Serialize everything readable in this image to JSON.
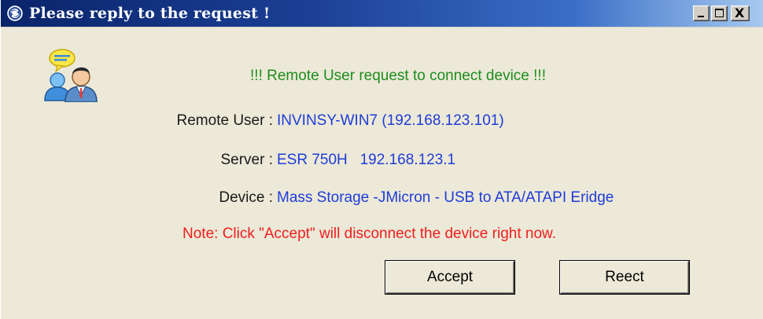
{
  "window": {
    "title": "Please reply to the request !",
    "title_icon": "app-globe-icon",
    "controls": {
      "minimize_icon": "minimize-icon",
      "maximize_icon": "maximize-icon",
      "close_icon": "close-icon",
      "close_glyph": "X"
    }
  },
  "dialog": {
    "icon": "remote-users-icon",
    "header_message": "!!! Remote User request to connect device !!!",
    "rows": [
      {
        "label": "Remote User :",
        "value": "INVINSY-WIN7 (192.168.123.101)"
      },
      {
        "label": "Server :",
        "value": "ESR 750H   192.168.123.1"
      },
      {
        "label": "Device :",
        "value": "Mass Storage -JMicron - USB to ATA/ATAPI Eridge"
      }
    ],
    "note": "Note: Click \"Accept\" will disconnect the device right now.",
    "buttons": {
      "accept": "Accept",
      "reject": "Reect"
    }
  },
  "colors": {
    "titlebar_start": "#0a246a",
    "titlebar_end": "#a6caf0",
    "header_message": "#1e8c1e",
    "value_text": "#1f3cd8",
    "note_text": "#f01e1e",
    "dialog_background": "#ece9d8"
  }
}
